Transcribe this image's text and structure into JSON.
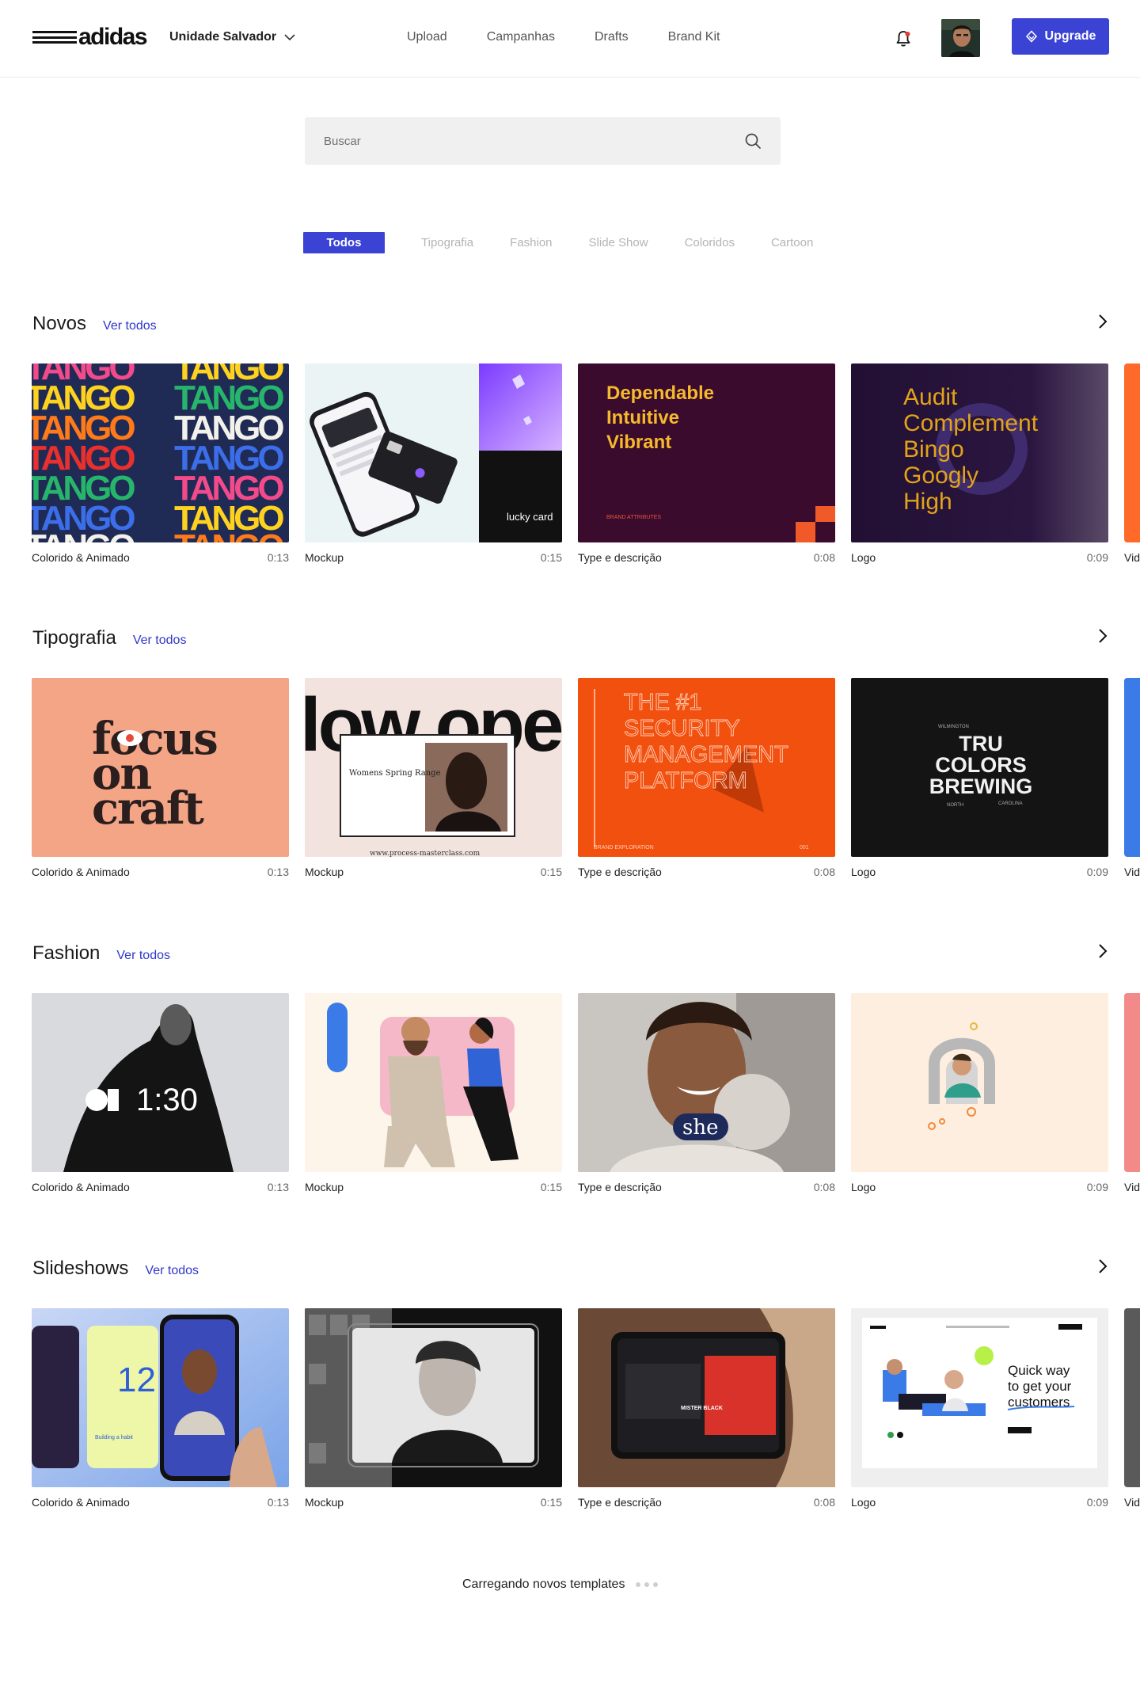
{
  "header": {
    "logo_text": "adidas",
    "unit_selector": "Unidade Salvador",
    "nav": [
      "Upload",
      "Campanhas",
      "Drafts",
      "Brand Kit"
    ],
    "upgrade_label": "Upgrade"
  },
  "search": {
    "placeholder": "Buscar"
  },
  "filters": {
    "tabs": [
      "Todos",
      "Tipografia",
      "Fashion",
      "Slide Show",
      "Coloridos",
      "Cartoon"
    ],
    "active": "Todos"
  },
  "link_label": "Ver todos",
  "sections": [
    {
      "title": "Novos",
      "cards": [
        {
          "label": "Colorido & Animado",
          "duration": "0:13"
        },
        {
          "label": "Mockup",
          "duration": "0:15"
        },
        {
          "label": "Type e descrição",
          "duration": "0:08"
        },
        {
          "label": "Logo",
          "duration": "0:09"
        }
      ],
      "peek_label": "Vid"
    },
    {
      "title": "Tipografia",
      "cards": [
        {
          "label": "Colorido & Animado",
          "duration": "0:13"
        },
        {
          "label": "Mockup",
          "duration": "0:15"
        },
        {
          "label": "Type e descrição",
          "duration": "0:08"
        },
        {
          "label": "Logo",
          "duration": "0:09"
        }
      ],
      "peek_label": "Vid"
    },
    {
      "title": "Fashion",
      "cards": [
        {
          "label": "Colorido & Animado",
          "duration": "0:13"
        },
        {
          "label": "Mockup",
          "duration": "0:15"
        },
        {
          "label": "Type e descrição",
          "duration": "0:08"
        },
        {
          "label": "Logo",
          "duration": "0:09"
        }
      ],
      "peek_label": "Vid"
    },
    {
      "title": "Slideshows",
      "cards": [
        {
          "label": "Colorido & Animado",
          "duration": "0:13"
        },
        {
          "label": "Mockup",
          "duration": "0:15"
        },
        {
          "label": "Type e descrição",
          "duration": "0:08"
        },
        {
          "label": "Logo",
          "duration": "0:09"
        }
      ],
      "peek_label": "Vid"
    }
  ],
  "thumb_text": {
    "tango_word": "TANGO",
    "lucky_card": "lucky card",
    "dependable": [
      "Dependable",
      "Intuitive",
      "Vibrant"
    ],
    "brand_attributes": "BRAND ATTRIBUTES",
    "audit_words": [
      "Audit",
      "Complement",
      "Bingo",
      "Googly",
      "High"
    ],
    "focus_words": [
      "focus",
      "on",
      "craft"
    ],
    "now_open": "low open",
    "womens_spring": "Womens Spring Range",
    "masterclass_url": "www.process-masterclass.com",
    "security_lines": [
      "THE #1",
      "SECURITY",
      "MANAGEMENT",
      "PLATFORM"
    ],
    "brand_exploration": "BRAND EXPLORATION",
    "brand_number": "001",
    "tru_lines": [
      "TRU",
      "COLORS",
      "BREWING"
    ],
    "wilmington": "WILMINGTON",
    "north": "NORTH",
    "carolina": "CAROLINA",
    "countdown": "1:30",
    "she_logo": "she",
    "slide_number": "12",
    "building_habit": "Building a habit",
    "mister_black": "MISTER BLACK",
    "quick_way": [
      "Quick way",
      "to get your",
      "customers"
    ]
  },
  "loading_text": "Carregando novos templates",
  "colors": {
    "accent": "#3a43d3",
    "link": "#2f38c8",
    "tab_inactive": "#b4b4b4"
  },
  "icons": {
    "unit_chevron": "chevron-down-icon",
    "bell": "bell-icon",
    "upgrade": "diamond-icon",
    "search": "search-icon",
    "section_arrow": "chevron-right-icon"
  }
}
